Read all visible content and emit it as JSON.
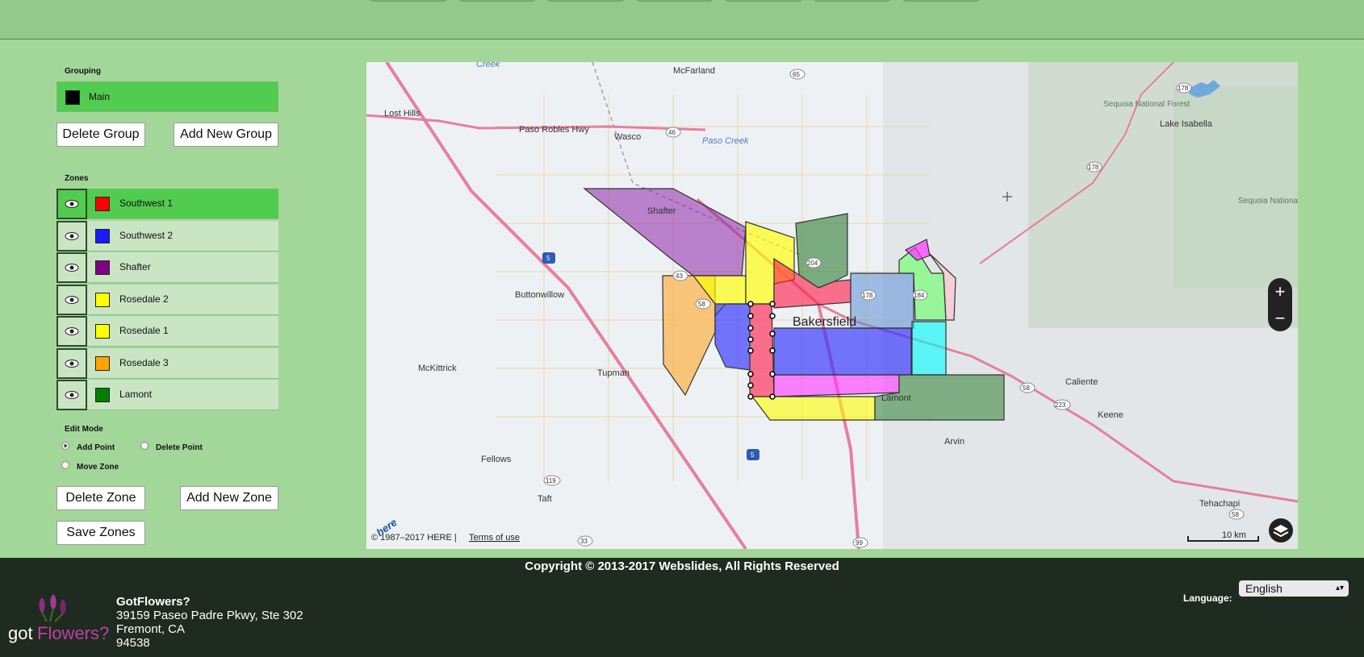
{
  "grouping": {
    "label": "Grouping",
    "groups": [
      {
        "name": "Main",
        "color": "#000000"
      }
    ],
    "delete_label": "Delete Group",
    "add_label": "Add New Group"
  },
  "zones": {
    "label": "Zones",
    "items": [
      {
        "name": "Southwest 1",
        "color": "#ff0000",
        "active": true
      },
      {
        "name": "Southwest 2",
        "color": "#1a1aff",
        "active": false
      },
      {
        "name": "Shafter",
        "color": "#800080",
        "active": false
      },
      {
        "name": "Rosedale 2",
        "color": "#ffff00",
        "active": false
      },
      {
        "name": "Rosedale 1",
        "color": "#ffff00",
        "active": false
      },
      {
        "name": "Rosedale 3",
        "color": "#ffa500",
        "active": false
      },
      {
        "name": "Lamont",
        "color": "#008000",
        "active": false
      }
    ]
  },
  "edit_mode": {
    "label": "Edit Mode",
    "options": [
      {
        "name": "Add Point",
        "selected": true
      },
      {
        "name": "Delete Point",
        "selected": false
      },
      {
        "name": "Move Zone",
        "selected": false
      }
    ]
  },
  "zone_actions": {
    "delete_label": "Delete Zone",
    "add_label": "Add New Zone",
    "save_label": "Save Zones"
  },
  "map": {
    "places": [
      "Creek",
      "McFarland",
      "Lost Hills",
      "Paso Robles Hwy",
      "Wasco",
      "Paso Creek",
      "Sequoia National Forest",
      "Lake Isabella",
      "Shafter",
      "Buttonwillow",
      "Bakersfield",
      "McKittrick",
      "Tupman",
      "Caliente",
      "Keene",
      "Lamont",
      "Arvin",
      "Fellows",
      "Taft",
      "Tehachapi",
      "Sequoia National Forest"
    ],
    "route_shields": [
      "65",
      "46",
      "178",
      "178",
      "43",
      "58",
      "5",
      "204",
      "178",
      "184",
      "58",
      "223",
      "119",
      "5",
      "33",
      "99",
      "58"
    ],
    "copyright": "© 1987–2017 HERE |",
    "terms_label": "Terms of use",
    "scale_label": "10 km",
    "logo_text": "here",
    "zoom_in_label": "+",
    "zoom_out_label": "−"
  },
  "footer": {
    "copyright": "Copyright © 2013-2017 Webslides, All Rights Reserved",
    "company": "GotFlowers?",
    "address_line1": "39159 Paseo Padre Pkwy, Ste 302",
    "address_line2": "Fremont, CA",
    "zip": "94538",
    "logo_text_a": "got",
    "logo_text_b": "Flowers?",
    "language_label": "Language:",
    "language_value": "English"
  }
}
